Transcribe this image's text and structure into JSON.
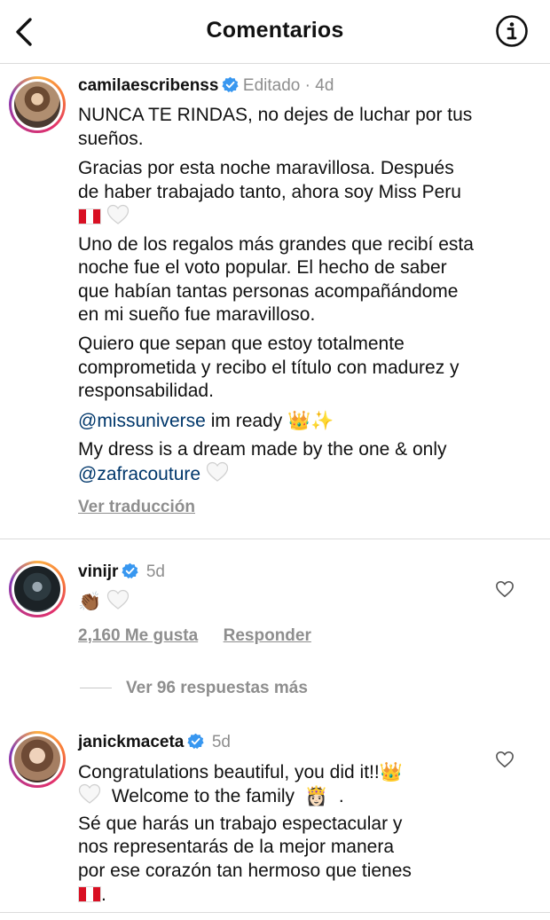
{
  "header": {
    "title": "Comentarios",
    "back_icon": "chevron-left-icon",
    "info_icon": "info-icon"
  },
  "post": {
    "username": "camilaescribenss",
    "edited": "Editado",
    "time": "4d",
    "lines": {
      "l1": "NUNCA TE RINDAS, no dejes de luchar por tus",
      "l2": "sueños.",
      "l3": "Gracias por esta noche maravillosa. Después",
      "l4": "de haber trabajado tanto, ahora soy Miss Peru",
      "l5": "Uno de los regalos más grandes que recibí esta",
      "l6": "noche fue el voto popular. El hecho de saber",
      "l7": "que habían tantas personas acompañándome",
      "l8": "en mi sueño fue maravilloso.",
      "l9": "Quiero que sepan que estoy totalmente",
      "l10": "comprometida y recibo el título con madurez y",
      "l11": "responsabilidad.",
      "mention1": "@missuniverse",
      "l12": "im ready",
      "l13": "My dress is a dream made by the one & only",
      "mention2": "@zafracouture"
    },
    "emojis": {
      "crown": "👑",
      "sparkles": "✨"
    },
    "translate": "Ver traducción"
  },
  "comments": [
    {
      "username": "vinijr",
      "time": "5d",
      "text": "👏🏾",
      "likes": "2,160 Me gusta",
      "reply": "Responder",
      "view_replies": "Ver 96 respuestas más"
    },
    {
      "username": "janickmaceta",
      "time": "5d",
      "l1": "Congratulations beautiful, you did it!!",
      "l2": "Welcome to the family",
      "l3": "Sé que harás un trabajo espectacular y",
      "l4": "nos representarás de la mejor manera",
      "l5": "por ese corazón tan hermoso que tienes",
      "emoji_crown": "👑",
      "emoji_princess": "👸🏻",
      "period": "."
    }
  ],
  "colors": {
    "verified": "#3897f0",
    "mention": "#00376b",
    "meta": "#8e8e8e",
    "divider": "#dbdbdb"
  }
}
